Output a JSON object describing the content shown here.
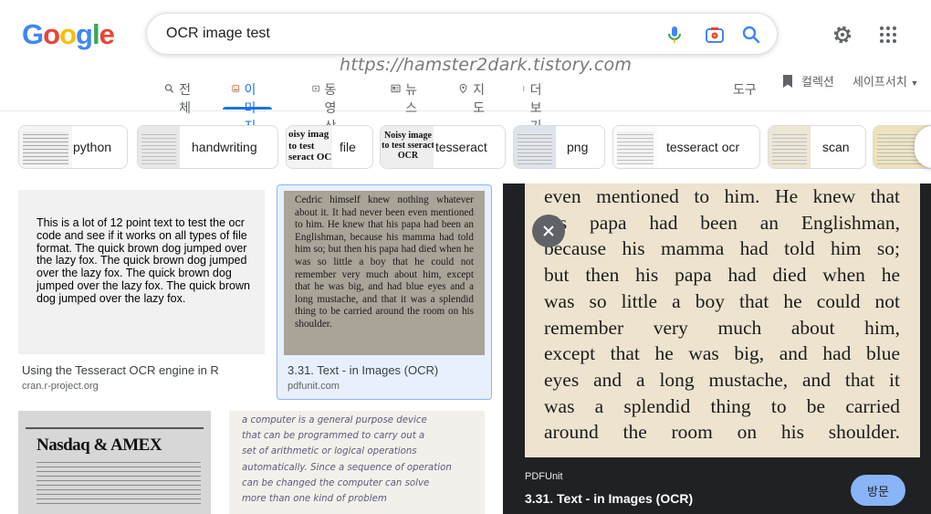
{
  "search": {
    "query": "OCR image test"
  },
  "watermark": "https://hamster2dark.tistory.com",
  "tabs": [
    {
      "label": "전체",
      "icon": "search-icon"
    },
    {
      "label": "이미지",
      "icon": "image-icon"
    },
    {
      "label": "동영상",
      "icon": "video-icon"
    },
    {
      "label": "뉴스",
      "icon": "news-icon"
    },
    {
      "label": "지도",
      "icon": "location-pin-icon"
    },
    {
      "label": "더보기",
      "icon": "more-vert-icon"
    }
  ],
  "toolbar": {
    "tools": "도구",
    "collections": "컬렉션",
    "safesearch": "세이프서치"
  },
  "chips": [
    {
      "label": "python"
    },
    {
      "label": "handwriting"
    },
    {
      "label": "file"
    },
    {
      "label": "tesseract"
    },
    {
      "label": "png"
    },
    {
      "label": "tesseract ocr"
    },
    {
      "label": "scan"
    }
  ],
  "chip_thumbs": {
    "file": "oisy imag to test seract OC",
    "tesseract": "Noisy image to test sseract OCR"
  },
  "results": [
    {
      "image_text": "This is a lot of 12 point text to test the ocr code and see if it works on  all types of file format. The quick brown dog jumped over the lazy fox. The quick brown dog jumped over the lazy fox. The quick brown dog  jumped over the lazy fox. The quick brown dog jumped over the lazy fox.",
      "title": "Using the Tesseract OCR engine in R",
      "source": "cran.r-project.org"
    },
    {
      "image_text": "Cedric himself knew nothing whatever about it. It had never been even mentioned to him. He knew that his papa had been an Englishman, because his mamma had told him so; but then his papa had died when he was so little a boy that he could not remember very much about him, except that he was big, and had blue eyes and a long mustache, and that it was a splendid thing to be carried around the room on his shoulder.",
      "title": "3.31. Text - in Images (OCR)",
      "source": "pdfunit.com"
    },
    {
      "image_text": "Nasdaq & AMEX"
    },
    {
      "image_lines": [
        "a computer is a general purpose device",
        "that can be programmed to carry out a",
        "set of arithmetic or logical operations",
        "automatically. Since a sequence of operation",
        "can be changed the computer can solve",
        "more than one kind of problem"
      ]
    }
  ],
  "preview": {
    "lines": [
      "even mentioned to him. He knew that",
      "his papa had been an Englishman,",
      "because his mamma had told him so;",
      "but then his papa had died when he",
      "was so little a boy that he could not",
      "remember very much about him,",
      "except that he was big, and had blue",
      "eyes and a long mustache, and that it",
      "was a splendid thing to be carried",
      "around the room on his shoulder."
    ],
    "source": "PDFUnit",
    "title": "3.31. Text - in Images (OCR)",
    "visit_label": "방문"
  },
  "colors": {
    "accent": "#1a73e8",
    "panel_bg": "#202124",
    "visit_bg": "#8ab4f8"
  }
}
